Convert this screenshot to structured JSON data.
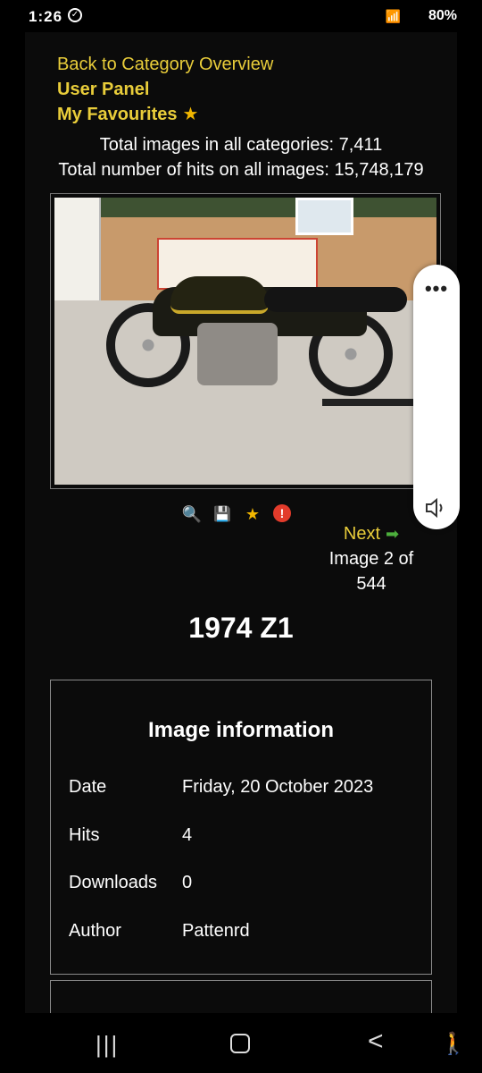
{
  "status_bar": {
    "time": "1:26",
    "battery": "80%"
  },
  "nav_links": {
    "back_to_category": "Back to Category Overview",
    "user_panel": "User Panel",
    "my_favourites": "My Favourites"
  },
  "stats": {
    "total_images": "Total images in all categories: 7,411",
    "total_hits": "Total number of hits on all images: 15,748,179"
  },
  "image_actions": [
    {
      "name": "zoom-icon"
    },
    {
      "name": "download-icon"
    },
    {
      "name": "favourite-icon"
    },
    {
      "name": "report-icon"
    }
  ],
  "pagination": {
    "next": "Next",
    "image_position": "Image 2 of 544"
  },
  "image_title": "1974 Z1",
  "image_info": {
    "title": "Image information",
    "rows": [
      {
        "key": "Date",
        "value": "Friday, 20 October 2023"
      },
      {
        "key": "Hits",
        "value": "4"
      },
      {
        "key": "Downloads",
        "value": "0"
      },
      {
        "key": "Author",
        "value": "Pattenrd"
      }
    ]
  },
  "system_nav": {
    "recent": "|||",
    "back": "<"
  },
  "colors": {
    "link": "#e9cd3a",
    "background": "#0b0b0b",
    "accent_green": "#4caf3c"
  }
}
